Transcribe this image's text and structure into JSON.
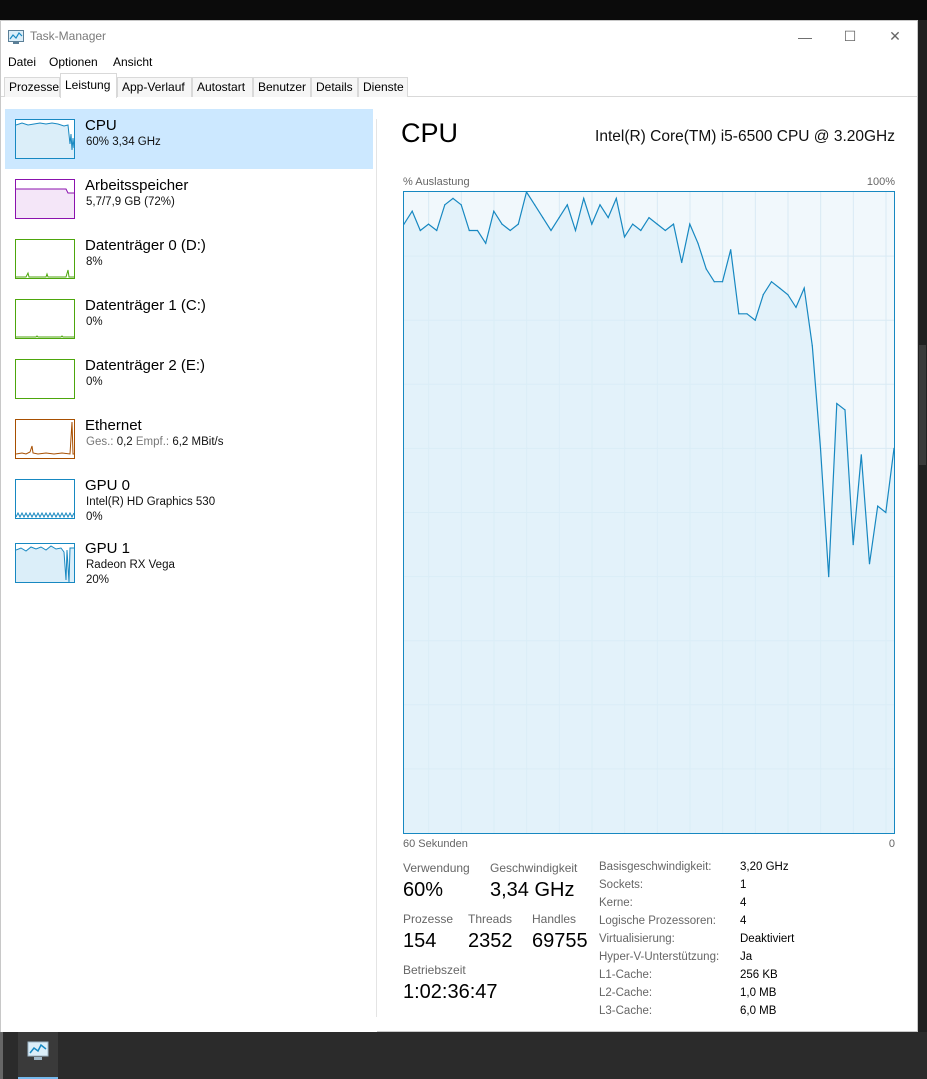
{
  "window": {
    "title": "Task-Manager",
    "controls": {
      "minimize": "—",
      "maximize": "☐",
      "close": "✕"
    }
  },
  "menu": [
    "Datei",
    "Optionen",
    "Ansicht"
  ],
  "tabs": [
    "Prozesse",
    "Leistung",
    "App-Verlauf",
    "Autostart",
    "Benutzer",
    "Details",
    "Dienste"
  ],
  "active_tab": "Leistung",
  "devices": [
    {
      "name": "CPU",
      "line1": "60% 3,34 GHz",
      "line2": "",
      "color": "#1788c1",
      "selected": true
    },
    {
      "name": "Arbeitsspeicher",
      "line1": "5,7/7,9 GB (72%)",
      "line2": "",
      "color": "#8b12ae",
      "selected": false
    },
    {
      "name": "Datenträger 0 (D:)",
      "line1": "8%",
      "line2": "",
      "color": "#4da60c",
      "selected": false
    },
    {
      "name": "Datenträger 1 (C:)",
      "line1": "0%",
      "line2": "",
      "color": "#4da60c",
      "selected": false
    },
    {
      "name": "Datenträger 2 (E:)",
      "line1": "0%",
      "line2": "",
      "color": "#4da60c",
      "selected": false
    },
    {
      "name": "Ethernet",
      "line1_dim_a": "Ges.:",
      "line1_a": "0,2",
      "line1_dim_b": "Empf.:",
      "line1_b": "6,2 MBit/s",
      "line2": "",
      "color": "#a74f01",
      "selected": false
    },
    {
      "name": "GPU 0",
      "line1": "Intel(R) HD Graphics 530",
      "line2": "0%",
      "color": "#1788c1",
      "selected": false
    },
    {
      "name": "GPU 1",
      "line1": "Radeon RX Vega",
      "line2": "20%",
      "color": "#1788c1",
      "selected": false
    }
  ],
  "detail": {
    "title": "CPU",
    "model": "Intel(R) Core(TM) i5-6500 CPU @ 3.20GHz",
    "y_label": "% Auslastung",
    "y_max_label": "100%",
    "x_left_label": "60 Sekunden",
    "x_right_label": "0",
    "stats": {
      "usage_label": "Verwendung",
      "usage_value": "60%",
      "speed_label": "Geschwindigkeit",
      "speed_value": "3,34 GHz",
      "processes_label": "Prozesse",
      "processes_value": "154",
      "threads_label": "Threads",
      "threads_value": "2352",
      "handles_label": "Handles",
      "handles_value": "69755",
      "uptime_label": "Betriebszeit",
      "uptime_value": "1:02:36:47"
    },
    "info": [
      {
        "label": "Basisgeschwindigkeit:",
        "value": "3,20 GHz"
      },
      {
        "label": "Sockets:",
        "value": "1"
      },
      {
        "label": "Kerne:",
        "value": "4"
      },
      {
        "label": "Logische Prozessoren:",
        "value": "4"
      },
      {
        "label": "Virtualisierung:",
        "value": "Deaktiviert"
      },
      {
        "label": "Hyper-V-Unterstützung:",
        "value": "Ja"
      },
      {
        "label": "L1-Cache:",
        "value": "256 KB"
      },
      {
        "label": "L2-Cache:",
        "value": "1,0 MB"
      },
      {
        "label": "L3-Cache:",
        "value": "6,0 MB"
      }
    ]
  },
  "chart_data": {
    "type": "line",
    "title": "CPU",
    "ylabel": "% Auslastung",
    "xlabel": "60 Sekunden",
    "ylim": [
      0,
      100
    ],
    "x_range_seconds": [
      60,
      0
    ],
    "grid": true,
    "series": [
      {
        "values": [
          95,
          97,
          94,
          95,
          94,
          98,
          99,
          98,
          94,
          94,
          92,
          97,
          95,
          94,
          95,
          100,
          98,
          96,
          94,
          96,
          98,
          94,
          99,
          95,
          98,
          96,
          99,
          93,
          95,
          94,
          96,
          95,
          94,
          95,
          89,
          95,
          92,
          88,
          86,
          86,
          91,
          81,
          81,
          80,
          84,
          86,
          85,
          84,
          82,
          85,
          76,
          60,
          40,
          67,
          66,
          45,
          59,
          42,
          51,
          50,
          60
        ]
      }
    ]
  },
  "taskbar": {
    "app": "Task-Manager"
  }
}
